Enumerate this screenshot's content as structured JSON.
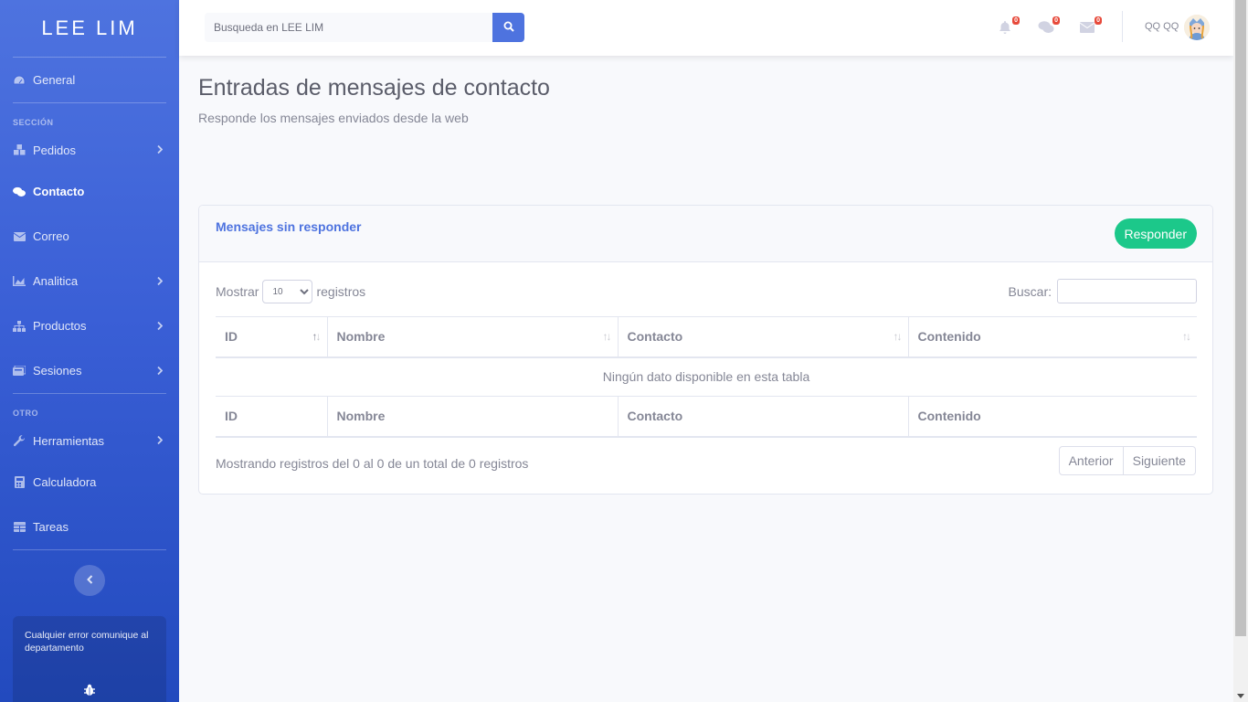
{
  "brand": "LEE LIM",
  "sidebar": {
    "items": [
      {
        "label": "General",
        "icon": "dashboard-icon"
      },
      {
        "label": "Pedidos",
        "icon": "boxes-icon"
      },
      {
        "label": "Contacto",
        "icon": "comments-icon"
      },
      {
        "label": "Correo",
        "icon": "envelope-icon"
      },
      {
        "label": "Analitica",
        "icon": "chart-area-icon"
      },
      {
        "label": "Productos",
        "icon": "sitemap-icon"
      },
      {
        "label": "Sesiones",
        "icon": "sessions-icon"
      },
      {
        "label": "Herramientas",
        "icon": "wrench-icon"
      },
      {
        "label": "Calculadora",
        "icon": "calculator-icon"
      },
      {
        "label": "Tareas",
        "icon": "table-icon"
      }
    ],
    "heading_section": "SECCIÓN",
    "heading_other": "OTRO",
    "card_text": "Cualquier error comunique al departamento"
  },
  "topbar": {
    "search_placeholder": "Busqueda en LEE LIM",
    "alerts_count": "0",
    "messages_count": "0",
    "mail_count": "0",
    "user_name": "QQ QQ"
  },
  "page": {
    "title": "Entradas de mensajes de contacto",
    "subtitle": "Responde los mensajes enviados desde la web"
  },
  "card": {
    "title": "Mensajes sin responder",
    "reply_button": "Responder",
    "length_prefix": "Mostrar",
    "length_value": "10",
    "length_suffix": "registros",
    "search_label": "Buscar:",
    "columns": [
      "ID",
      "Nombre",
      "Contacto",
      "Contenido"
    ],
    "empty_message": "Ningún dato disponible en esta tabla",
    "info": "Mostrando registros del 0 al 0 de un total de 0 registros",
    "prev": "Anterior",
    "next": "Siguiente"
  },
  "colors": {
    "primary": "#4e73df",
    "success": "#1cc88a",
    "danger": "#e74a3b"
  }
}
